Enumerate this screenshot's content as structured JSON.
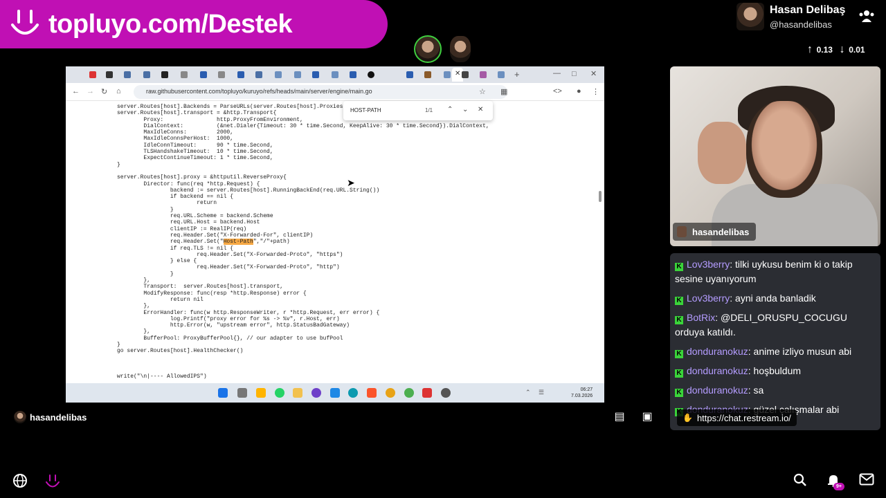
{
  "banner": {
    "text": "topluyo.com/Destek"
  },
  "host": {
    "name": "Hasan Delibaş",
    "handle": "@hasandelibas",
    "upvotes": "0.13",
    "downvotes": "0.01"
  },
  "browser": {
    "url": "raw.githubusercontent.com/topluyo/kuruyo/refs/heads/main/server/engine/main.go",
    "find": {
      "query": "HOST-PATH",
      "count": "1/1"
    },
    "clock": {
      "time": "06:27",
      "date": "7.03.2026"
    },
    "code_lines": [
      "server.Routes[host].Backends = ParseURLs(server.Routes[host].Proxies)",
      "server.Routes[host].transport = &http.Transport{",
      "        Proxy:                http.ProxyFromEnvironment,",
      "        DialContext:          (&net.Dialer{Timeout: 30 * time.Second, KeepAlive: 30 * time.Second}).DialContext,",
      "        MaxIdleConns:         2000,",
      "        MaxIdleConnsPerHost:  1000,",
      "        IdleConnTimeout:      90 * time.Second,",
      "        TLSHandshakeTimeout:  10 * time.Second,",
      "        ExpectContinueTimeout: 1 * time.Second,",
      "}",
      "",
      "server.Routes[host].proxy = &httputil.ReverseProxy{",
      "        Director: func(req *http.Request) {",
      "                backend := server.Routes[host].RunningBackEnd(req.URL.String())",
      "                if backend == nil {",
      "                        return",
      "                }",
      "                req.URL.Scheme = backend.Scheme",
      "                req.URL.Host = backend.Host",
      "                clientIP := RealIP(req)",
      "                req.Header.Set(\"X-Forwarded-For\", clientIP)",
      "                req.Header.Set(\"",
      "                if req.TLS != nil {",
      "                        req.Header.Set(\"X-Forwarded-Proto\", \"https\")",
      "                } else {",
      "                        req.Header.Set(\"X-Forwarded-Proto\", \"http\")",
      "                }",
      "        },",
      "        Transport:  server.Routes[host].transport,",
      "        ModifyResponse: func(resp *http.Response) error {",
      "                return nil",
      "        },",
      "        ErrorHandler: func(w http.ResponseWriter, r *http.Request, err error) {",
      "                log.Printf(\"proxy error for %s -> %v\", r.Host, err)",
      "                http.Error(w, \"upstream error\", http.StatusBadGateway)",
      "        },",
      "        BufferPool: ProxyBufferPool{}, // our adapter to use bufPool",
      "}",
      "go server.Routes[host].HealthChecker()",
      "",
      "",
      "",
      "write(\"\\n|---- AllowedIPS\")"
    ],
    "highlight_word": "Host-Path",
    "highlight_suffix": "\",\"/\"+path)"
  },
  "channel": {
    "name": "hasandelibas"
  },
  "webcam": {
    "label": "hasandelibas"
  },
  "chat": {
    "messages": [
      {
        "user": "Lov3berry",
        "text": "tilki uykusu benim ki o takip sesine uyanıyorum"
      },
      {
        "user": "Lov3berry",
        "text": "ayni anda banladik"
      },
      {
        "user": "BotRix",
        "text": "@DELI_ORUSPU_COCUGU orduya katıldı."
      },
      {
        "user": "donduranokuz",
        "text": "anime izliyo musun abi"
      },
      {
        "user": "donduranokuz",
        "text": "hoşbuldum"
      },
      {
        "user": "donduranokuz",
        "text": "sa"
      },
      {
        "user": "donduranokuz",
        "text": "güzel çalışmalar abi"
      }
    ],
    "link_preview": "https://chat.restream.io/"
  },
  "notifications": {
    "badge": "9+"
  }
}
